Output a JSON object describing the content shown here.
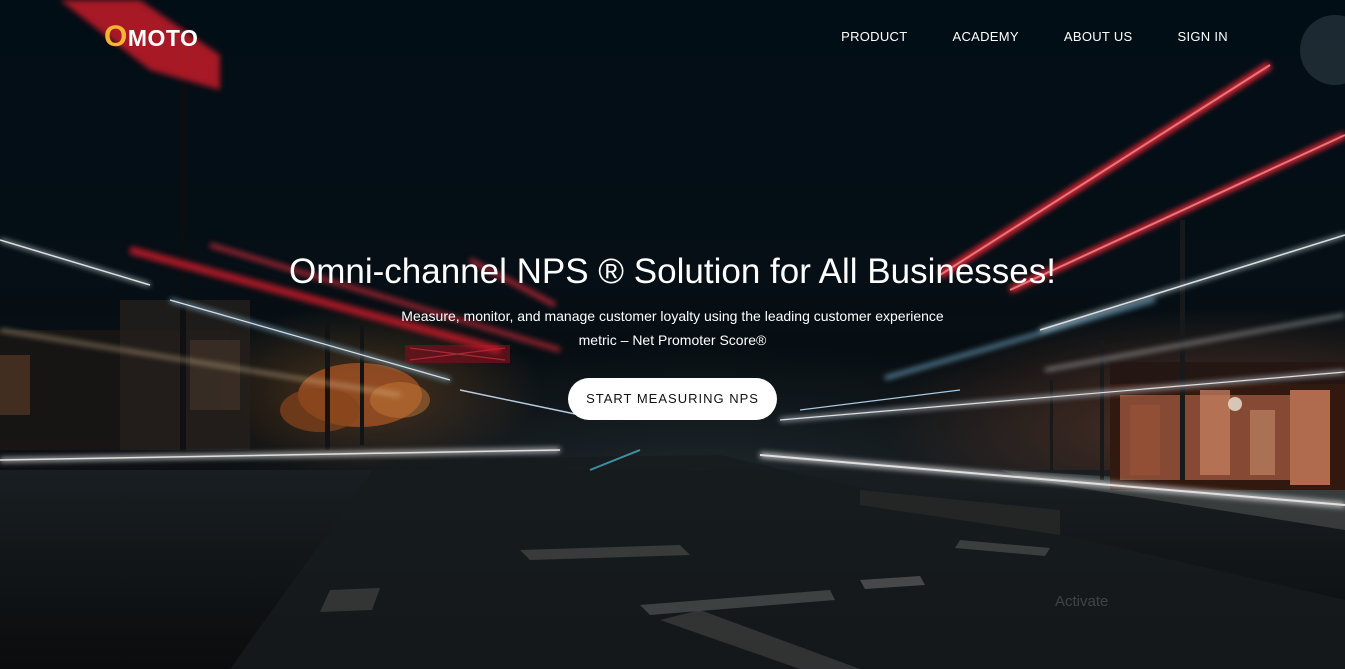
{
  "brand": {
    "logo_first_letter": "O",
    "logo_rest": "MOTO",
    "accent_color": "#f5b431"
  },
  "nav": {
    "items": [
      {
        "label": "PRODUCT"
      },
      {
        "label": "ACADEMY"
      },
      {
        "label": "ABOUT US"
      },
      {
        "label": "SIGN IN"
      }
    ]
  },
  "hero": {
    "headline": "Omni-channel NPS ® Solution for All Businesses!",
    "subtext": "Measure, monitor, and manage customer loyalty using the leading customer experience metric – Net Promoter Score®",
    "cta_label": "START MEASURING NPS",
    "background": "night street with red and white light trails"
  },
  "overlay": {
    "watermark_text": "Activate"
  }
}
